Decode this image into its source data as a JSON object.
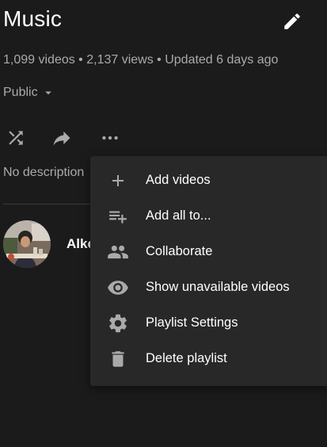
{
  "playlist": {
    "title": "Music",
    "stats": "1,099 videos • 2,137 views • Updated 6 days ago",
    "privacy": "Public",
    "description": "No description",
    "owner": "Alke"
  },
  "menu": {
    "items": [
      {
        "label": "Add videos",
        "icon": "plus-icon"
      },
      {
        "label": "Add all to...",
        "icon": "playlist-add-icon"
      },
      {
        "label": "Collaborate",
        "icon": "people-icon"
      },
      {
        "label": "Show unavailable videos",
        "icon": "eye-icon"
      },
      {
        "label": "Playlist Settings",
        "icon": "gear-icon"
      },
      {
        "label": "Delete playlist",
        "icon": "trash-icon"
      }
    ]
  },
  "colors": {
    "background": "#1b1b1b",
    "menu_background": "#282828",
    "secondary_text": "#aaaaaa",
    "icon": "#aaaaaa"
  }
}
